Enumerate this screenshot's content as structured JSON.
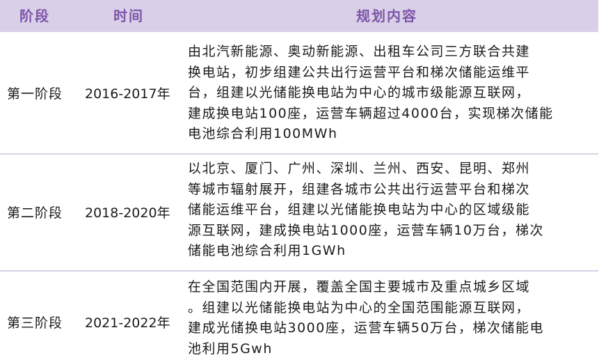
{
  "header": {
    "stage": "阶段",
    "time": "时间",
    "content": "规划内容"
  },
  "rows": [
    {
      "stage": "第一阶段",
      "time": "2016-2017年",
      "lines": [
        "由北汽新能源、奥动新能源、出租车公司三方联合共建",
        "换电站，初步组建公共出行运营平台和梯次储能运维平",
        "台，组建以光储能换电站为中心的城市级能源互联网，",
        "建成换电站100座，运营车辆超过4000台，实现梯次储能",
        "电池综合利用100MWh"
      ]
    },
    {
      "stage": "第二阶段",
      "time": "2018-2020年",
      "lines": [
        "以北京、厦门、广州、深圳、兰州、西安、昆明、郑州",
        "等城市辐射展开，组建各城市公共出行运营平台和梯次",
        "储能运维平台，组建以光储能换电站为中心的区域级能",
        "源互联网，建成换电站1000座，运营车辆10万台，梯次",
        "储能电池综合利用1GWh"
      ]
    },
    {
      "stage": "第三阶段",
      "time": "2021-2022年",
      "lines": [
        "在全国范围内开展，覆盖全国主要城市及重点城乡区域",
        "。组建以光储能换电站为中心的全国范围能源互联网，",
        "建成光储换电站3000座，运营车辆50万台，梯次储能电",
        "池利用5Gwh"
      ]
    }
  ]
}
